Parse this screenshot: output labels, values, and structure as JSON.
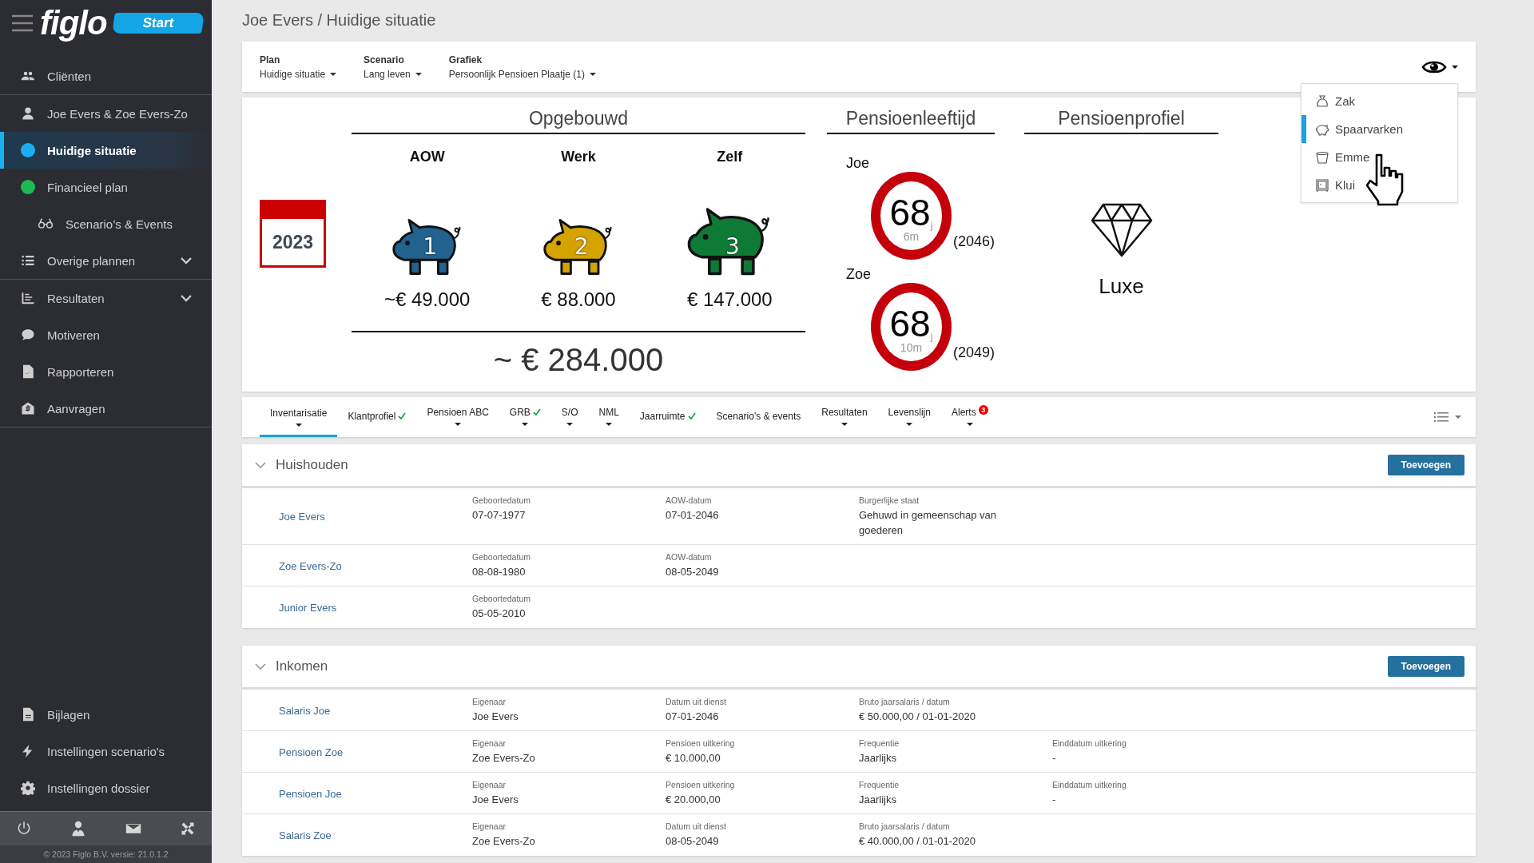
{
  "sidebar": {
    "logo": "figlo",
    "start_button": "Start",
    "groups": [
      [
        {
          "label": "Cliënten",
          "selected": false
        }
      ],
      [
        {
          "label": "Joe Evers & Zoe Evers-Zo",
          "selected": false
        },
        {
          "label": "Huidige situatie",
          "selected": true,
          "color": "#1ab0f0"
        },
        {
          "label": "Financieel plan",
          "selected": false,
          "color": "#1db954",
          "children": [
            {
              "label": "Scenario’s & Events",
              "selected": false
            }
          ]
        },
        {
          "label": "Overige plannen",
          "selected": false,
          "expanded": false
        }
      ],
      [
        {
          "label": "Resultaten",
          "selected": false,
          "expanded": false
        },
        {
          "label": "Motiveren",
          "selected": false
        },
        {
          "label": "Rapporteren",
          "selected": false
        },
        {
          "label": "Aanvragen",
          "selected": false
        }
      ]
    ],
    "bottom_items": [
      {
        "label": "Bijlagen"
      },
      {
        "label": "Instellingen scenario's"
      },
      {
        "label": "Instellingen dossier"
      }
    ],
    "footer": "© 2023 Figlo B.V. versie: 21.0.1.2"
  },
  "breadcrumb": "Joe Evers / Huidige situatie",
  "toolbar": {
    "selectors": [
      {
        "label": "Plan",
        "value": "Huidige situatie"
      },
      {
        "label": "Scenario",
        "value": "Lang leven"
      },
      {
        "label": "Grafiek",
        "value": "Persoonlijk Pensioen Plaatje (1)"
      }
    ]
  },
  "view_menu": {
    "items": [
      {
        "label": "Zak",
        "selected": false
      },
      {
        "label": "Spaarvarken",
        "selected": true
      },
      {
        "label": "Emme",
        "selected": false
      },
      {
        "label": "Klui",
        "selected": false
      }
    ]
  },
  "summary": {
    "year": "2023",
    "built_up": {
      "title": "Opgebouwd",
      "pillars": [
        {
          "label": "AOW",
          "number": "1",
          "amount": "~€ 49.000",
          "color": "#22628f"
        },
        {
          "label": "Werk",
          "number": "2",
          "amount": "€ 88.000",
          "color": "#d4a300"
        },
        {
          "label": "Zelf",
          "number": "3",
          "amount": "€ 147.000",
          "color": "#0f7a36"
        }
      ],
      "total": "~ € 284.000"
    },
    "retirement_age": {
      "title": "Pensioenleeftijd",
      "persons": [
        {
          "name": "Joe",
          "age": "68",
          "unit": "j",
          "months": "6m",
          "year": "(2046)"
        },
        {
          "name": "Zoe",
          "age": "68",
          "unit": "j",
          "months": "10m",
          "year": "(2049)"
        }
      ]
    },
    "profile": {
      "title": "Pensioenprofiel",
      "value": "Luxe"
    }
  },
  "tabs": {
    "items": [
      {
        "label": "Inventarisatie",
        "selected": true,
        "done": false,
        "dropdown": true
      },
      {
        "label": "Klantprofiel",
        "selected": false,
        "done": true,
        "dropdown": false
      },
      {
        "label": "Pensioen ABC",
        "selected": false,
        "done": false,
        "dropdown": true
      },
      {
        "label": "GRB",
        "selected": false,
        "done": true,
        "dropdown": true
      },
      {
        "label": "S/O",
        "selected": false,
        "done": false,
        "dropdown": true
      },
      {
        "label": "NML",
        "selected": false,
        "done": false,
        "dropdown": true
      },
      {
        "label": "Jaarruimte",
        "selected": false,
        "done": true,
        "dropdown": false
      },
      {
        "label": "Scenario's & events",
        "selected": false,
        "done": false,
        "dropdown": false
      },
      {
        "label": "Resultaten",
        "selected": false,
        "done": false,
        "dropdown": true
      },
      {
        "label": "Levenslijn",
        "selected": false,
        "done": false,
        "dropdown": true
      },
      {
        "label": "Alerts",
        "selected": false,
        "done": false,
        "dropdown": true,
        "badge": "3"
      }
    ]
  },
  "sections": [
    {
      "title": "Huishouden",
      "button": "Toevoegen",
      "rows": [
        {
          "name": "Joe Evers",
          "fields": [
            {
              "label": "Geboortedatum",
              "value": "07-07-1977"
            },
            {
              "label": "AOW-datum",
              "value": "07-01-2046"
            },
            {
              "label": "Burgerlijke staat",
              "value": "Gehuwd in gemeenschap van goederen"
            }
          ]
        },
        {
          "name": "Zoe Evers-Zo",
          "fields": [
            {
              "label": "Geboortedatum",
              "value": "08-08-1980"
            },
            {
              "label": "AOW-datum",
              "value": "08-05-2049"
            }
          ]
        },
        {
          "name": "Junior Evers",
          "fields": [
            {
              "label": "Geboortedatum",
              "value": "05-05-2010"
            }
          ]
        }
      ]
    },
    {
      "title": "Inkomen",
      "button": "Toevoegen",
      "rows": [
        {
          "name": "Salaris Joe",
          "fields": [
            {
              "label": "Eigenaar",
              "value": "Joe Evers"
            },
            {
              "label": "Datum uit dienst",
              "value": "07-01-2046"
            },
            {
              "label": "Bruto jaarsalaris / datum",
              "value": "€ 50.000,00 / 01-01-2020"
            }
          ]
        },
        {
          "name": "Pensioen Zoe",
          "fields": [
            {
              "label": "Eigenaar",
              "value": "Zoe Evers-Zo"
            },
            {
              "label": "Pensioen uitkering",
              "value": "€ 10.000,00"
            },
            {
              "label": "Frequentie",
              "value": "Jaarlijks"
            },
            {
              "label": "Einddatum uitkering",
              "value": "-"
            }
          ]
        },
        {
          "name": "Pensioen Joe",
          "fields": [
            {
              "label": "Eigenaar",
              "value": "Joe Evers"
            },
            {
              "label": "Pensioen uitkering",
              "value": "€ 20.000,00"
            },
            {
              "label": "Frequentie",
              "value": "Jaarlijks"
            },
            {
              "label": "Einddatum uitkering",
              "value": "-"
            }
          ]
        },
        {
          "name": "Salaris Zoe",
          "fields": [
            {
              "label": "Eigenaar",
              "value": "Zoe Evers-Zo"
            },
            {
              "label": "Datum uit dienst",
              "value": "08-05-2049"
            },
            {
              "label": "Bruto jaarsalaris / datum",
              "value": "€ 40.000,00 / 01-01-2020"
            }
          ]
        }
      ]
    }
  ]
}
